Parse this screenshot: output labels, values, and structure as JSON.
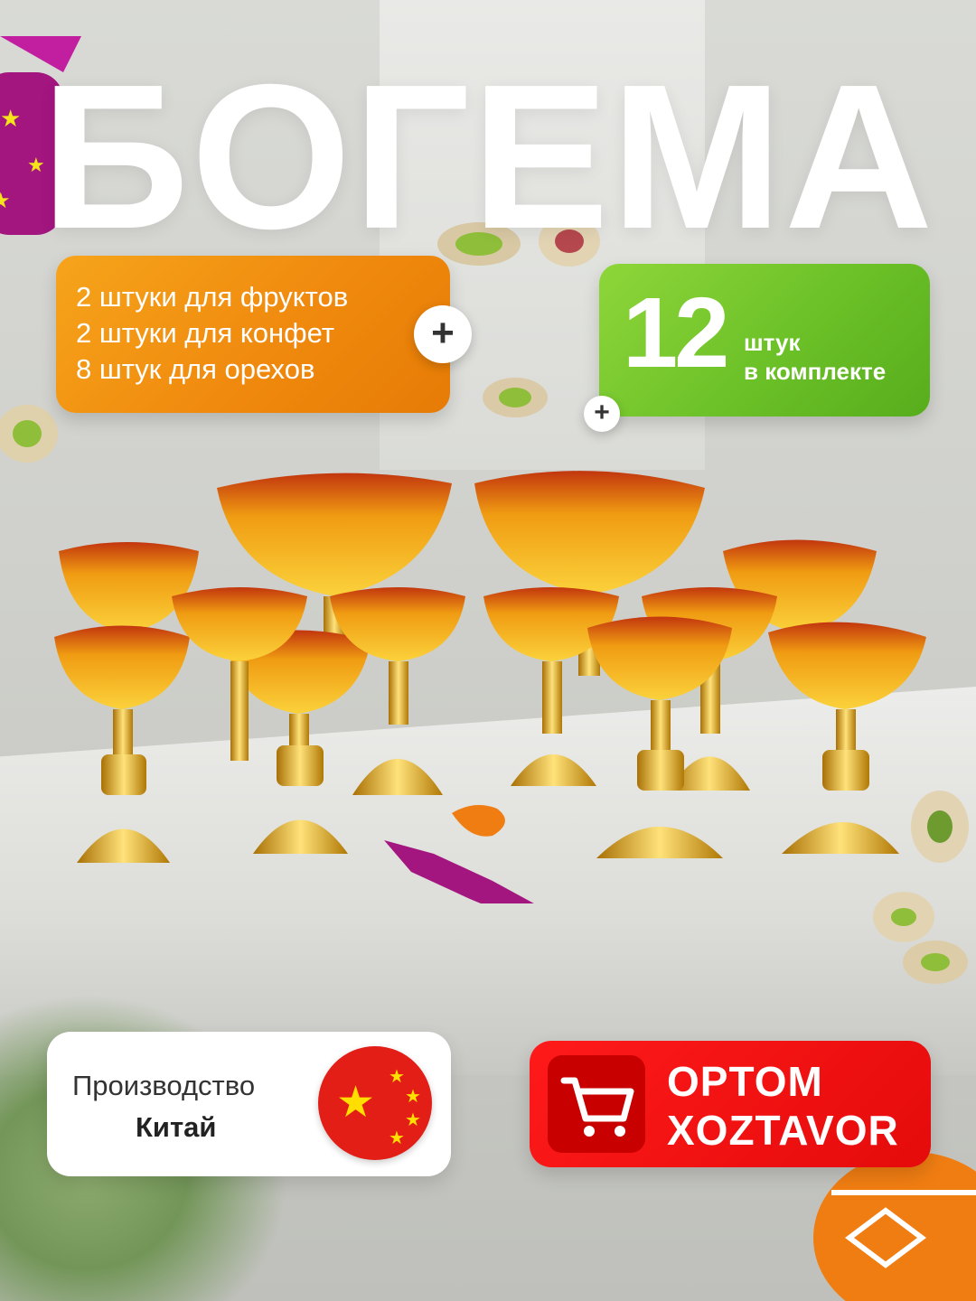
{
  "title": "БОГЕМА",
  "contents": {
    "lines": [
      "2 штуки для фруктов",
      "2 штуки для конфет",
      "8 штук для орехов"
    ]
  },
  "set_count": {
    "number": "12",
    "unit": "штук",
    "caption": "в комплекте"
  },
  "plus_symbol": "+",
  "origin": {
    "label": "Производство",
    "country": "Китай",
    "flag_icon": "china-flag-icon"
  },
  "seller": {
    "line1": "OPTOM",
    "line2": "XOZTAVOR",
    "icon": "shopping-cart-icon"
  },
  "colors": {
    "orange": "#f08a0e",
    "green": "#6cc128",
    "red": "#e50b0b",
    "gold": "#e8a80c"
  }
}
